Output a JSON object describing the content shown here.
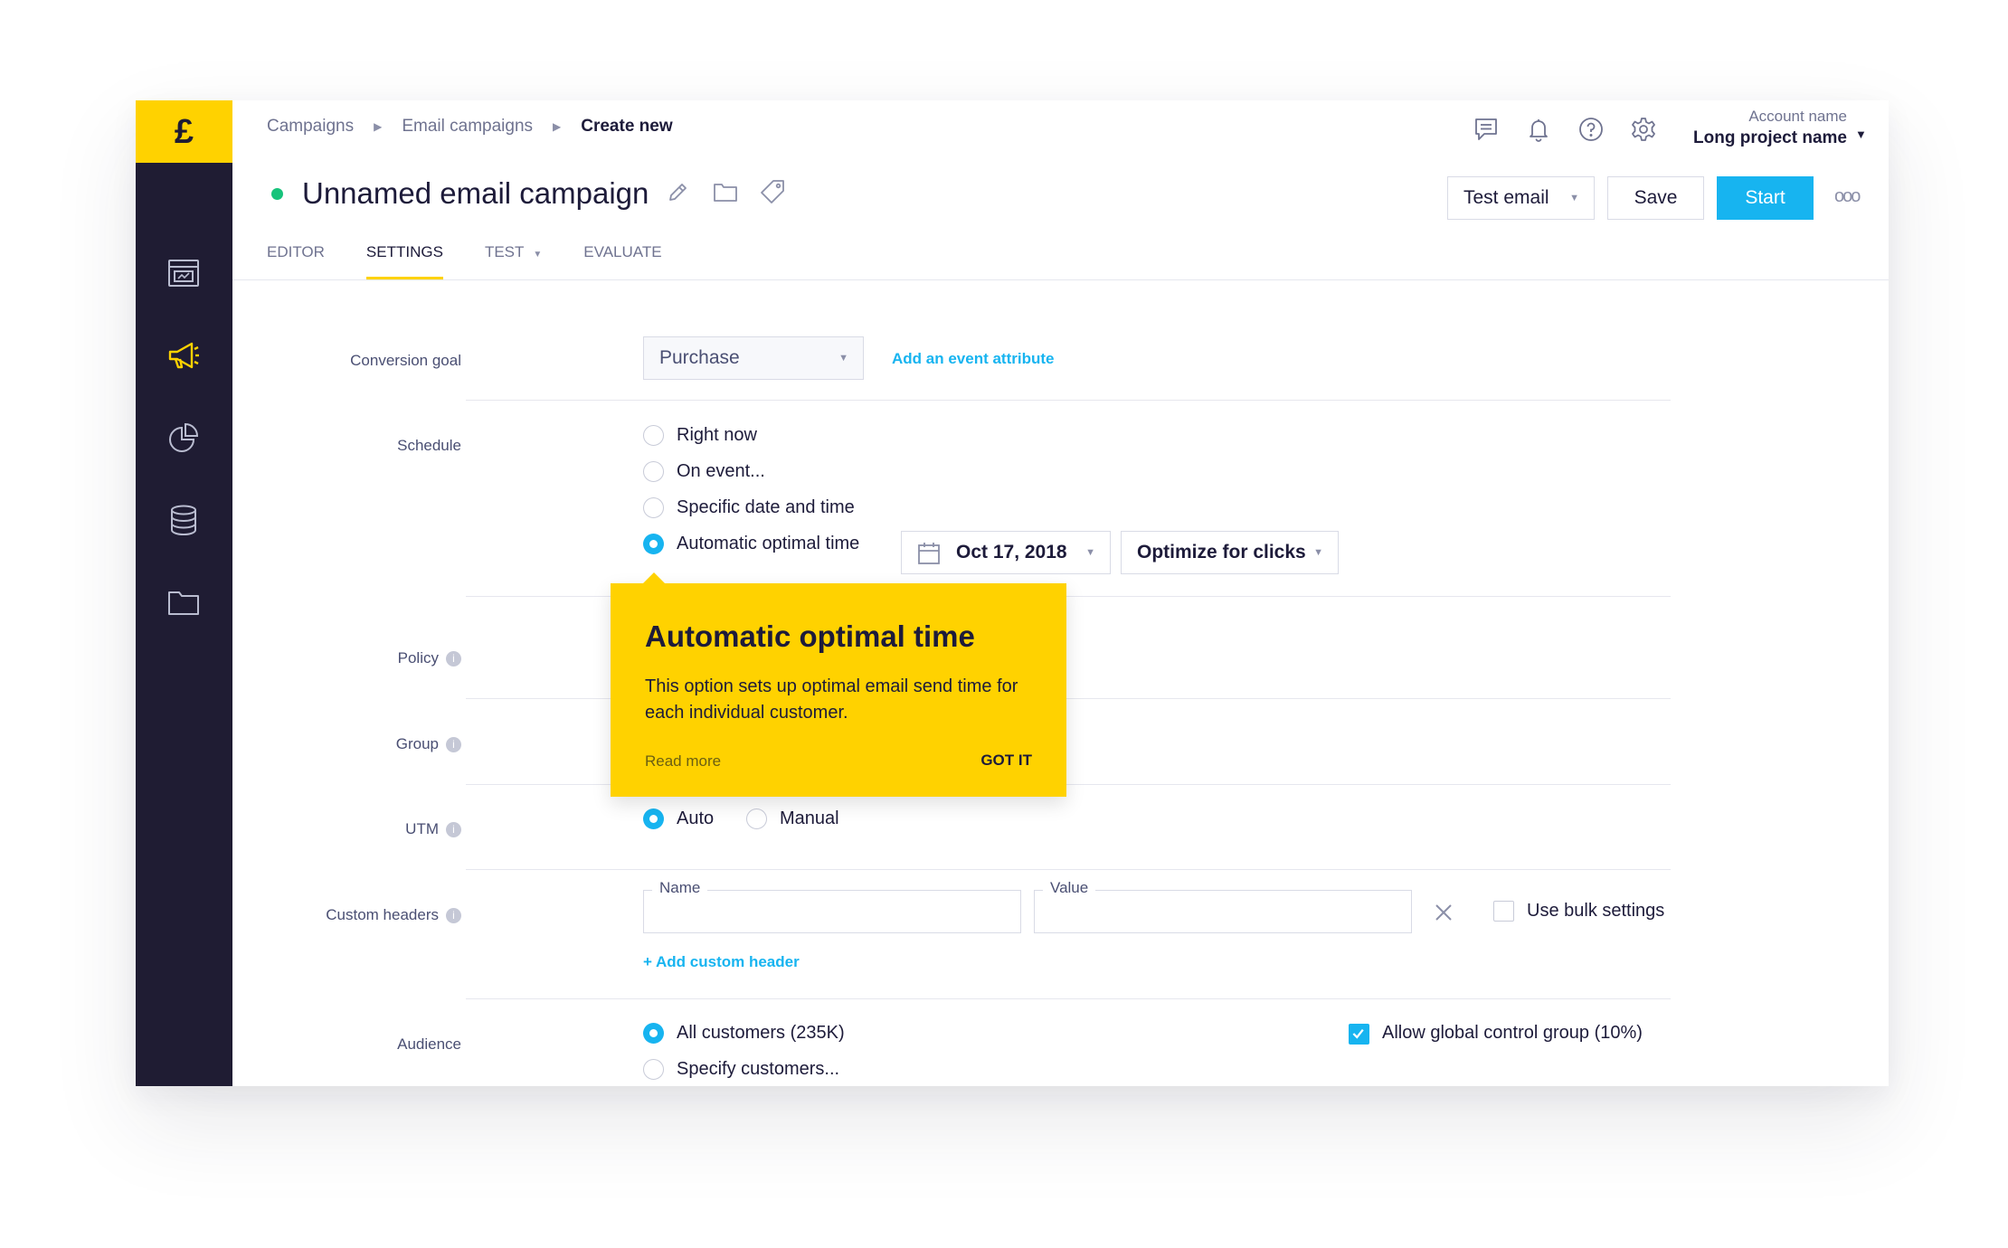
{
  "sidebar": {
    "logo": "£",
    "items": [
      {
        "icon": "analytics-dashboard-icon",
        "active": false
      },
      {
        "icon": "megaphone-icon",
        "active": true
      },
      {
        "icon": "pie-chart-icon",
        "active": false
      },
      {
        "icon": "database-icon",
        "active": false
      },
      {
        "icon": "folder-icon",
        "active": false
      }
    ]
  },
  "header": {
    "breadcrumbs": [
      "Campaigns",
      "Email campaigns",
      "Create new"
    ],
    "icons": [
      "chat-icon",
      "bell-icon",
      "help-icon",
      "settings-gear-icon"
    ],
    "account_name": "Account name",
    "project_name": "Long project name"
  },
  "campaign": {
    "title": "Unnamed email campaign",
    "status_color": "#17c37b",
    "buttons": {
      "test_email": "Test email",
      "save": "Save",
      "start": "Start"
    }
  },
  "tabs": [
    {
      "label": "EDITOR",
      "active": false
    },
    {
      "label": "SETTINGS",
      "active": true
    },
    {
      "label": "TEST",
      "active": false
    },
    {
      "label": "EVALUATE",
      "active": false
    }
  ],
  "form": {
    "conversion_goal": {
      "label": "Conversion goal",
      "value": "Purchase",
      "link": "Add an event attribute"
    },
    "schedule": {
      "label": "Schedule",
      "options": [
        "Right now",
        "On event...",
        "Specific date and time",
        "Automatic optimal time"
      ],
      "selected": "Automatic optimal time",
      "date": "Oct 17, 2018",
      "optimize": "Optimize for clicks"
    },
    "policy": {
      "label": "Policy"
    },
    "group": {
      "label": "Group"
    },
    "utm": {
      "label": "UTM",
      "options": [
        "Auto",
        "Manual"
      ],
      "selected": "Auto"
    },
    "custom_headers": {
      "label": "Custom headers",
      "name_label": "Name",
      "value_label": "Value",
      "name_value": "",
      "value_value": "",
      "bulk_label": "Use bulk settings",
      "bulk_checked": false,
      "add_link": "+ Add custom header"
    },
    "audience": {
      "label": "Audience",
      "options": [
        "All customers (235K)",
        "Specify customers..."
      ],
      "selected": "All customers (235K)",
      "control_group_label": "Allow global control group (10%)",
      "control_group_checked": true
    }
  },
  "tooltip": {
    "title": "Automatic optimal time",
    "body": "This option sets up optimal email send time for each individual customer.",
    "read_more": "Read more",
    "got_it": "GOT IT"
  },
  "colors": {
    "accent": "#17b4f0",
    "brand_yellow": "#ffd200",
    "sidebar_bg": "#1f1c33"
  }
}
